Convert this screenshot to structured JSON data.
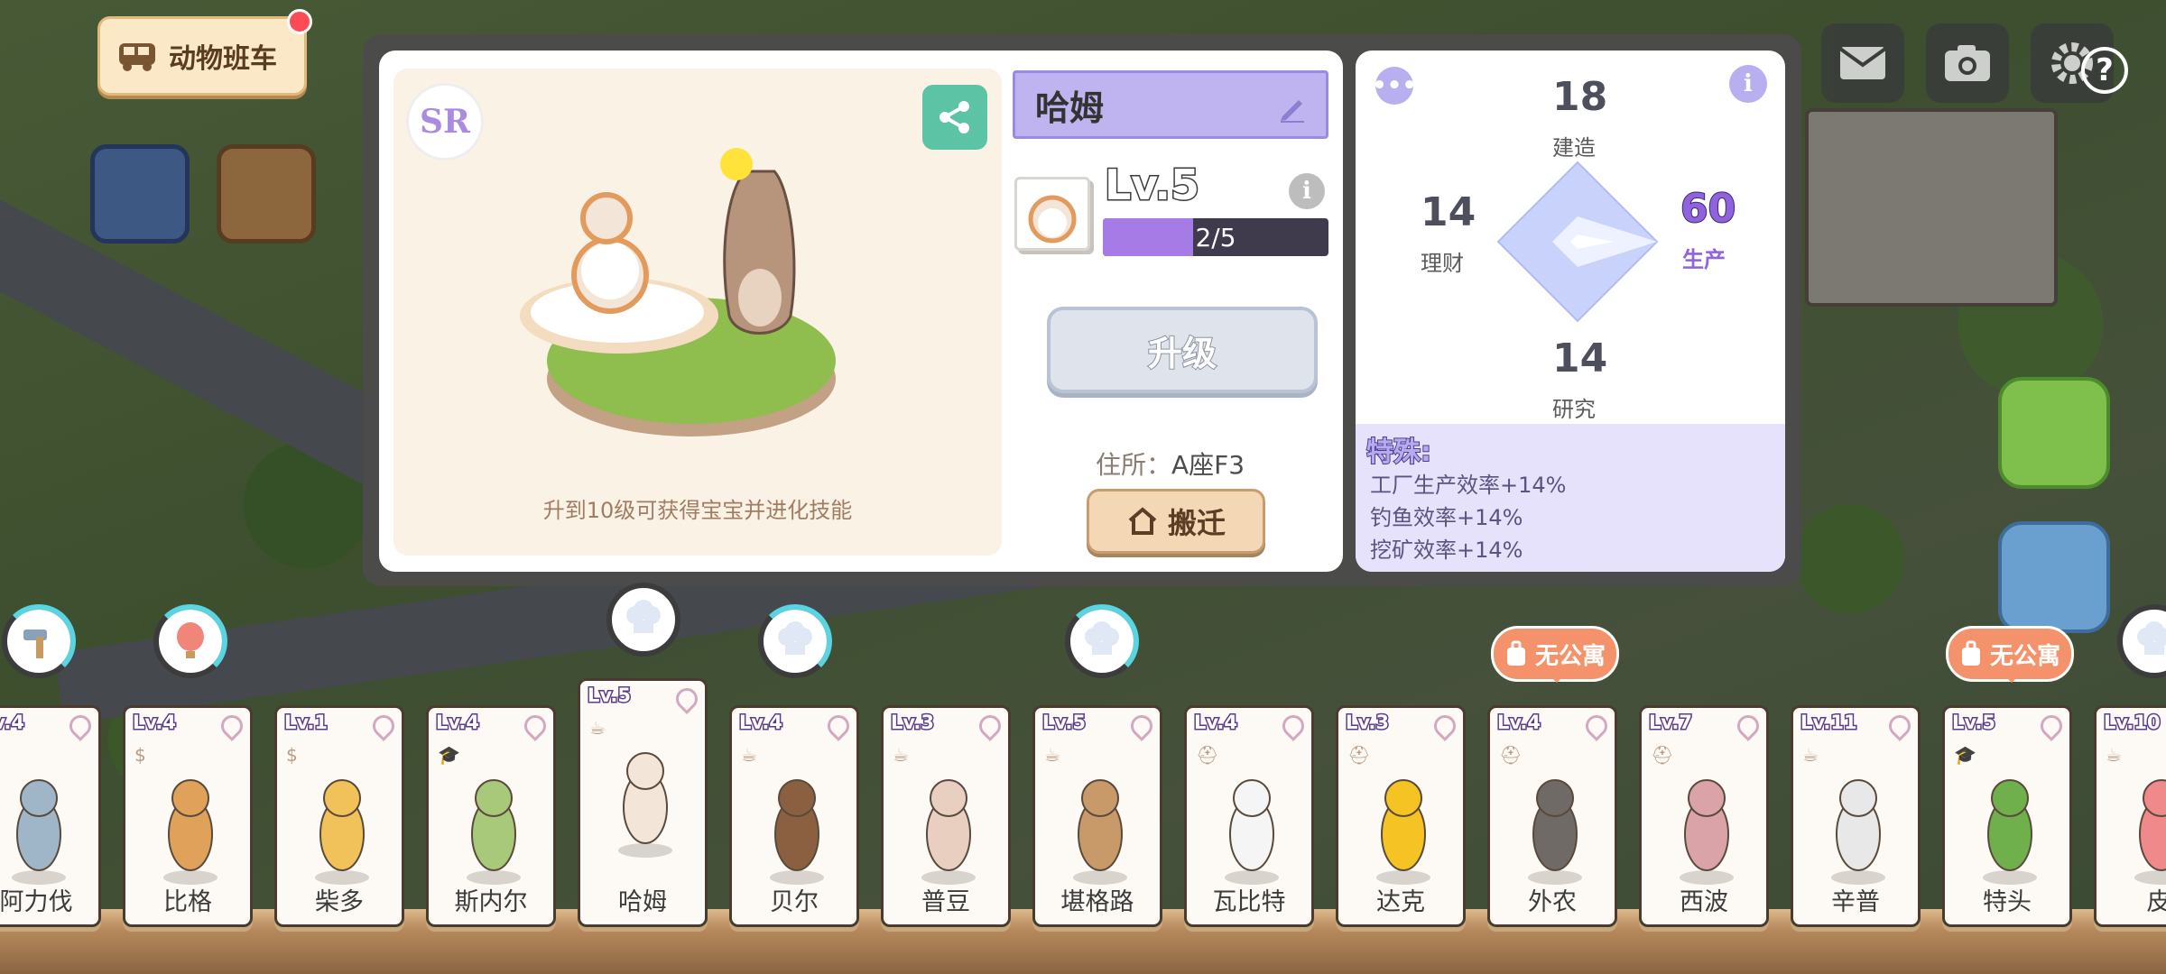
{
  "hud": {
    "bus_label": "动物班车",
    "help_label": "?"
  },
  "animal": {
    "rarity": "SR",
    "name": "哈姆",
    "level_text": "Lv.5",
    "xp_text": "2/5",
    "xp_progress": 0.4,
    "upgrade_label": "升级",
    "address_label": "住所：",
    "address_value": "A座F3",
    "move_label": "搬迁",
    "evolve_hint": "升到10级可获得宝宝并进化技能"
  },
  "stats": {
    "build": {
      "value": "18",
      "label": "建造"
    },
    "finance": {
      "value": "14",
      "label": "理财"
    },
    "production": {
      "value": "60",
      "label": "生产"
    },
    "research": {
      "value": "14",
      "label": "研究"
    },
    "special_title": "特殊:",
    "special_items": [
      "工厂生产效率+14%",
      "钓鱼效率+14%",
      "挖矿效率+14%"
    ]
  },
  "no_apartment_label": "无公寓",
  "cards": [
    {
      "lv": "Lv.4",
      "name": "阿力伐",
      "job": "☕"
    },
    {
      "lv": "Lv.4",
      "name": "比格",
      "job": "$"
    },
    {
      "lv": "Lv.1",
      "name": "柴多",
      "job": "$"
    },
    {
      "lv": "Lv.4",
      "name": "斯内尔",
      "job": "🎓"
    },
    {
      "lv": "Lv.5",
      "name": "哈姆",
      "job": "☕"
    },
    {
      "lv": "Lv.4",
      "name": "贝尔",
      "job": "☕"
    },
    {
      "lv": "Lv.3",
      "name": "普豆",
      "job": "☕"
    },
    {
      "lv": "Lv.5",
      "name": "堪格路",
      "job": "☕"
    },
    {
      "lv": "Lv.4",
      "name": "瓦比特",
      "job": "⛑"
    },
    {
      "lv": "Lv.3",
      "name": "达克",
      "job": "⛑"
    },
    {
      "lv": "Lv.4",
      "name": "外农",
      "job": "⛑"
    },
    {
      "lv": "Lv.7",
      "name": "西波",
      "job": "⛑"
    },
    {
      "lv": "Lv.11",
      "name": "辛普",
      "job": "☕"
    },
    {
      "lv": "Lv.5",
      "name": "特头",
      "job": "🎓"
    },
    {
      "lv": "Lv.10",
      "name": "皮",
      "job": "☕"
    }
  ],
  "colors": {
    "accent_purple": "#9062e0",
    "share_green": "#5cc3a4",
    "no_apartment_orange": "#f3926b",
    "progress_cyan": "#5ad4e0"
  }
}
